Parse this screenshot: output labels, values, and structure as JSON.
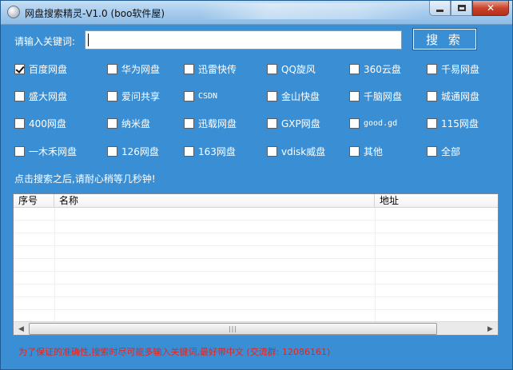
{
  "window": {
    "title": "网盘搜索精灵-V1.0  (boo软件屋)",
    "controls": {
      "minimize_icon": "minimize-icon",
      "maximize_icon": "maximize-icon",
      "close_glyph": "✕"
    }
  },
  "search": {
    "label": "请输入关键词:",
    "value": "",
    "button_label": "搜 索"
  },
  "options": [
    {
      "label": "百度网盘",
      "checked": true
    },
    {
      "label": "华为网盘",
      "checked": false
    },
    {
      "label": "迅雷快传",
      "checked": false
    },
    {
      "label": "QQ旋风",
      "checked": false
    },
    {
      "label": "360云盘",
      "checked": false
    },
    {
      "label": "千易网盘",
      "checked": false
    },
    {
      "label": "盛大网盘",
      "checked": false
    },
    {
      "label": "爱问共享",
      "checked": false
    },
    {
      "label": "CSDN",
      "checked": false
    },
    {
      "label": "金山快盘",
      "checked": false
    },
    {
      "label": "千脑网盘",
      "checked": false
    },
    {
      "label": "城通网盘",
      "checked": false
    },
    {
      "label": "400网盘",
      "checked": false
    },
    {
      "label": "纳米盘",
      "checked": false
    },
    {
      "label": "迅载网盘",
      "checked": false
    },
    {
      "label": "GXP网盘",
      "checked": false
    },
    {
      "label": "good.gd",
      "checked": false
    },
    {
      "label": "115网盘",
      "checked": false
    },
    {
      "label": "一木禾网盘",
      "checked": false
    },
    {
      "label": "126网盘",
      "checked": false
    },
    {
      "label": "163网盘",
      "checked": false
    },
    {
      "label": "vdisk威盘",
      "checked": false
    },
    {
      "label": "其他",
      "checked": false
    },
    {
      "label": "全部",
      "checked": false
    }
  ],
  "hint": "点击搜索之后,请耐心稍等几秒钟!",
  "results": {
    "columns": [
      "序号",
      "名称",
      "地址"
    ],
    "rows": []
  },
  "footer_note": "为了保证的准确性,搜索时尽可能多输入关键词,最好带中文 (交流群: 12086161)"
}
